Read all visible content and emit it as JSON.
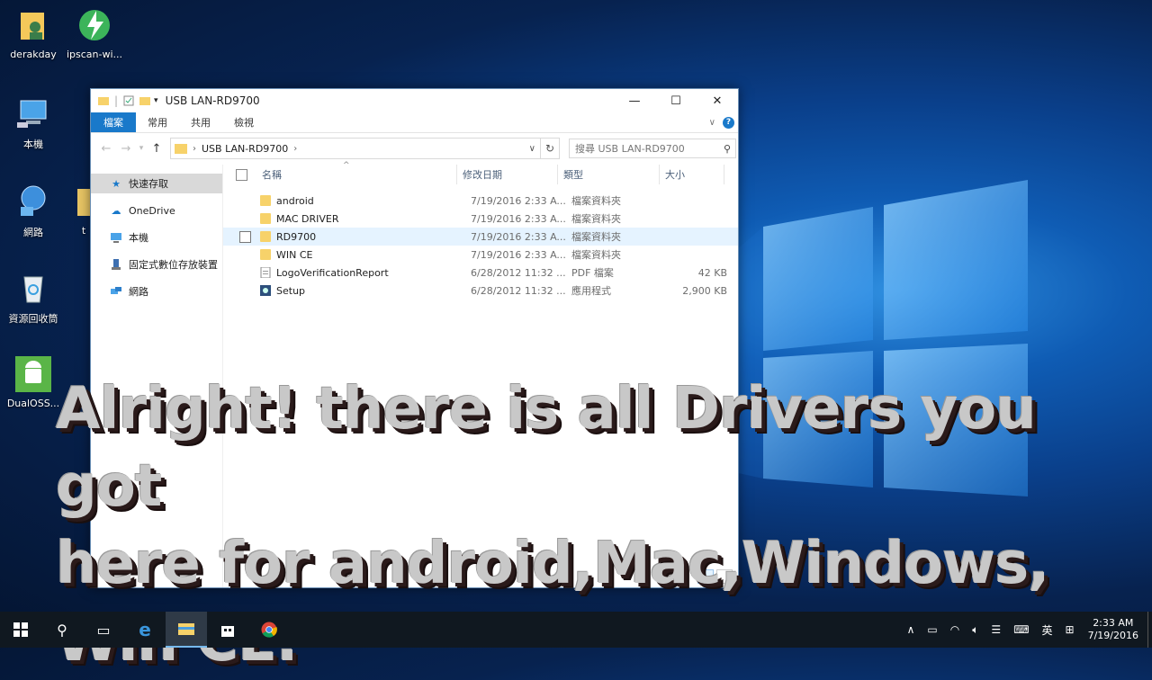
{
  "desktop": {
    "icons": [
      {
        "label": "derakday"
      },
      {
        "label": "ipscan-wi..."
      },
      {
        "label": "本機"
      },
      {
        "label": "網路"
      },
      {
        "label": "資源回收筒"
      },
      {
        "label": "DualOSS..."
      },
      {
        "label": "t"
      }
    ]
  },
  "window": {
    "title": "USB LAN-RD9700",
    "controls": {
      "minimize": "—",
      "maximize": "☐",
      "close": "✕"
    },
    "ribbon": {
      "tabs": [
        "檔案",
        "常用",
        "共用",
        "檢視"
      ]
    },
    "address": {
      "path": "USB LAN-RD9700",
      "sep": "›"
    },
    "search": {
      "placeholder": "搜尋 USB LAN-RD9700"
    },
    "nav": [
      {
        "label": "快速存取"
      },
      {
        "label": "OneDrive"
      },
      {
        "label": "本機"
      },
      {
        "label": "固定式數位存放裝置"
      },
      {
        "label": "網路"
      }
    ],
    "columns": {
      "name": "名稱",
      "date": "修改日期",
      "type": "類型",
      "size": "大小"
    },
    "files": [
      {
        "name": "android",
        "date": "7/19/2016 2:33 A...",
        "type": "檔案資料夾",
        "size": "",
        "kind": "folder"
      },
      {
        "name": "MAC DRIVER",
        "date": "7/19/2016 2:33 A...",
        "type": "檔案資料夾",
        "size": "",
        "kind": "folder"
      },
      {
        "name": "RD9700",
        "date": "7/19/2016 2:33 A...",
        "type": "檔案資料夾",
        "size": "",
        "kind": "folder"
      },
      {
        "name": "WIN CE",
        "date": "7/19/2016 2:33 A...",
        "type": "檔案資料夾",
        "size": "",
        "kind": "folder"
      },
      {
        "name": "LogoVerificationReport",
        "date": "6/28/2012 11:32 ...",
        "type": "PDF 檔案",
        "size": "42 KB",
        "kind": "pdf"
      },
      {
        "name": "Setup",
        "date": "6/28/2012 11:32 ...",
        "type": "應用程式",
        "size": "2,900 KB",
        "kind": "exe"
      }
    ]
  },
  "caption": {
    "line1": "Alright! there is all Drivers you got",
    "line2": "here for android,Mac,Windows,",
    "line3": "Win CE."
  },
  "taskbar": {
    "tray": {
      "ime": "英",
      "time": "2:33 AM",
      "date": "7/19/2016"
    }
  },
  "colors": {
    "accent": "#1979ca",
    "folder": "#f7d26a",
    "selection": "#e5f3ff",
    "taskbar": "#101820"
  }
}
